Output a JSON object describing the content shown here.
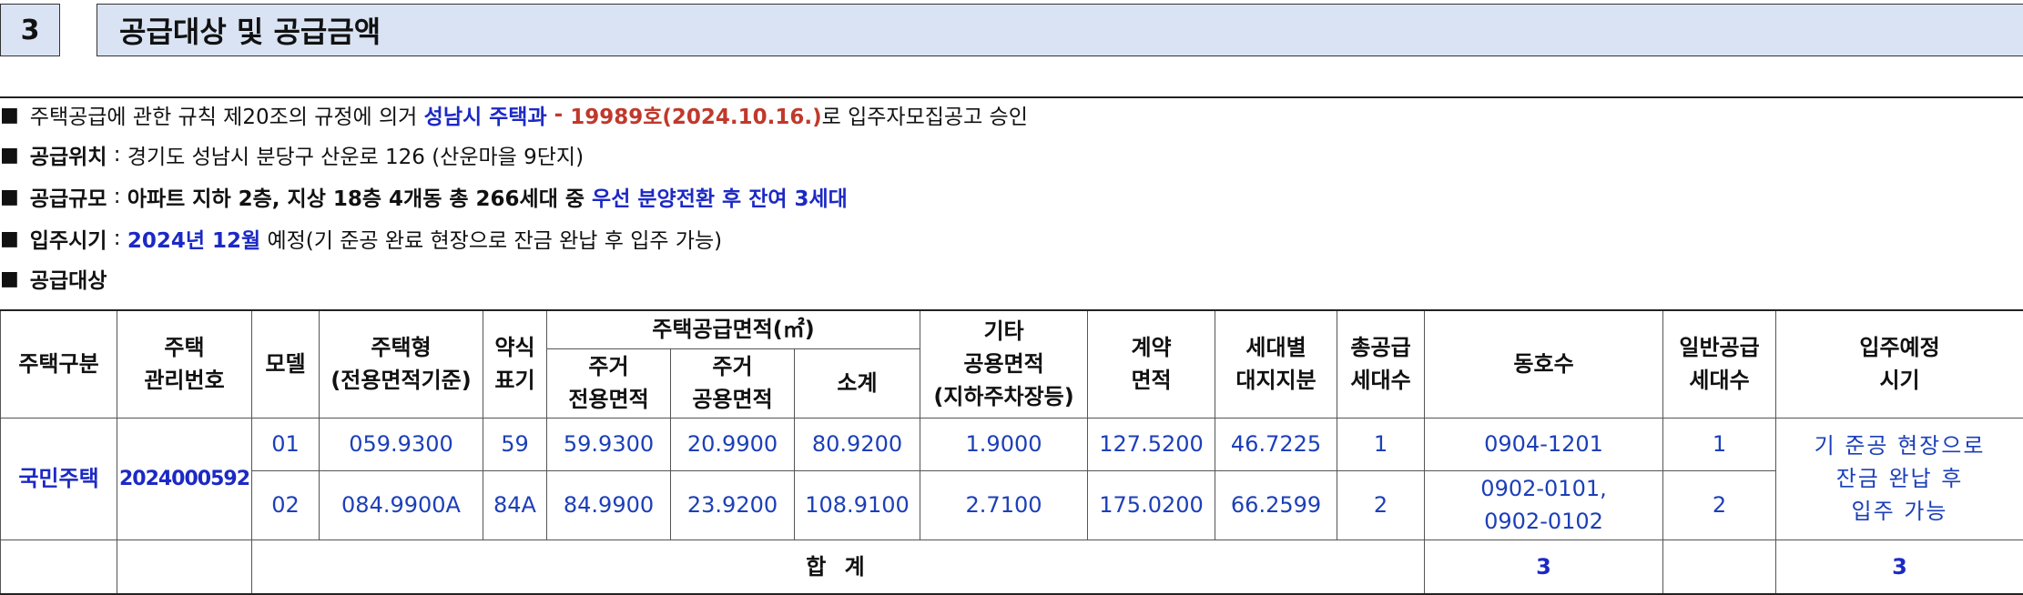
{
  "section": {
    "number": "3",
    "title": "공급대상 및 공급금액"
  },
  "lines": {
    "line1": {
      "bullet": "■",
      "pre": "주택공급에 관한 규칙 제20조의 규정에 의거 ",
      "office": "성남시 주택과",
      "dash": " - ",
      "approval": "19989호(2024.10.16.)",
      "post": "로 입주자모집공고 승인"
    },
    "line2": {
      "bullet": "■",
      "label": "공급위치",
      "sep": " : ",
      "value": "경기도 성남시 분당구 산운로 126 (산운마을 9단지)"
    },
    "line3": {
      "bullet": "■",
      "label": "공급규모",
      "sep": " : ",
      "value": "아파트 지하 2층, 지상 18층 4개동 총 266세대 중 ",
      "highlight": "우선 분양전환 후 잔여 3세대"
    },
    "line4": {
      "bullet": "■",
      "label": "입주시기",
      "sep": " : ",
      "date": "2024년 12월",
      "value": " 예정(기 준공 완료 현장으로 잔금 완납 후 입주 가능)"
    },
    "line5": {
      "bullet": "■",
      "label": "공급대상"
    }
  },
  "table": {
    "headers": {
      "kind": "주택구분",
      "mgmt_line1": "주택",
      "mgmt_line2": "관리번호",
      "model": "모델",
      "type_line1": "주택형",
      "type_line2": "(전용면적기준)",
      "abbr_line1": "약식",
      "abbr_line2": "표기",
      "supply_area": "주택공급면적(㎡)",
      "excl_line1": "주거",
      "excl_line2": "전용면적",
      "common_line1": "주거",
      "common_line2": "공용면적",
      "subtotal": "소계",
      "other_line1": "기타",
      "other_line2": "공용면적",
      "other_line3": "(지하주차장등)",
      "contract_line1": "계약",
      "contract_line2": "면적",
      "land_line1": "세대별",
      "land_line2": "대지지분",
      "total_line1": "총공급",
      "total_line2": "세대수",
      "units": "동호수",
      "general_line1": "일반공급",
      "general_line2": "세대수",
      "movein_line1": "입주예정",
      "movein_line2": "시기"
    },
    "kind": "국민주택",
    "mgmt_no": "2024000592",
    "rows": [
      {
        "model": "01",
        "type": "059.9300",
        "abbr": "59",
        "excl": "59.9300",
        "common": "20.9900",
        "subtotal": "80.9200",
        "other": "1.9000",
        "contract": "127.5200",
        "land": "46.7225",
        "total": "1",
        "units_line1": "0904-1201",
        "units_line2": "",
        "general": "1"
      },
      {
        "model": "02",
        "type": "084.9900A",
        "abbr": "84A",
        "excl": "84.9900",
        "common": "23.9200",
        "subtotal": "108.9100",
        "other": "2.7100",
        "contract": "175.0200",
        "land": "66.2599",
        "total": "2",
        "units_line1": "0902-0101,",
        "units_line2": "0902-0102",
        "general": "2"
      }
    ],
    "movein": {
      "line1": "기 준공 현장으로",
      "line2": "잔금 완납 후",
      "line3": "입주 가능"
    },
    "total_row": {
      "label": "합 계",
      "total": "3",
      "general": "3"
    }
  }
}
